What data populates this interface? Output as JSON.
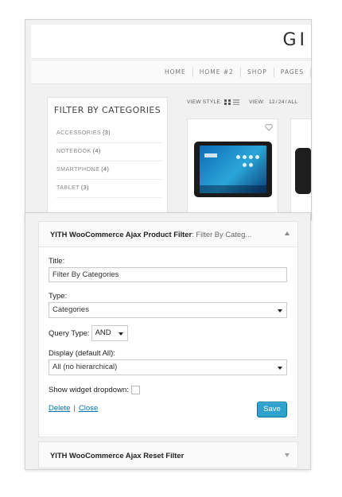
{
  "store": {
    "logo_text": "GI",
    "nav": [
      "HOME",
      "HOME #2",
      "SHOP",
      "PAGES"
    ],
    "sidebar_title": "FILTER BY CATEGORIES",
    "categories": [
      {
        "name": "ACCESSORIES",
        "count": "(3)"
      },
      {
        "name": "NOTEBOOK",
        "count": "(4)"
      },
      {
        "name": "SMARTPHONE",
        "count": "(4)"
      },
      {
        "name": "TABLET",
        "count": "(3)"
      }
    ],
    "view_style_label": "VIEW STYLE:",
    "view_label": "VIEW:",
    "view_options": [
      "12",
      "24",
      "ALL"
    ],
    "view_separator": "/",
    "icons": {
      "grid": "grid-view-icon",
      "list": "list-view-icon",
      "wishlist": "heart-icon"
    }
  },
  "widget": {
    "title_bold": "YITH WooCommerce Ajax Product Filter",
    "title_suffix": ": Filter By Categ...",
    "title_label": "Title:",
    "title_value": "Filter By Categories",
    "type_label": "Type:",
    "type_value": "Categories",
    "query_type_label": "Query Type:",
    "query_type_value": "AND",
    "display_label": "Display (default All):",
    "display_value": "All (no hierarchical)",
    "dropdown_label": "Show widget dropdown:",
    "dropdown_checked": false,
    "delete_link": "Delete",
    "separator": "|",
    "close_link": "Close",
    "save_label": "Save"
  },
  "widget2": {
    "title": "YITH WooCommerce Ajax Reset Filter"
  },
  "colors": {
    "link": "#0073aa",
    "save_button": "#2ea2cc",
    "panel_background": "#f1f1f1"
  }
}
